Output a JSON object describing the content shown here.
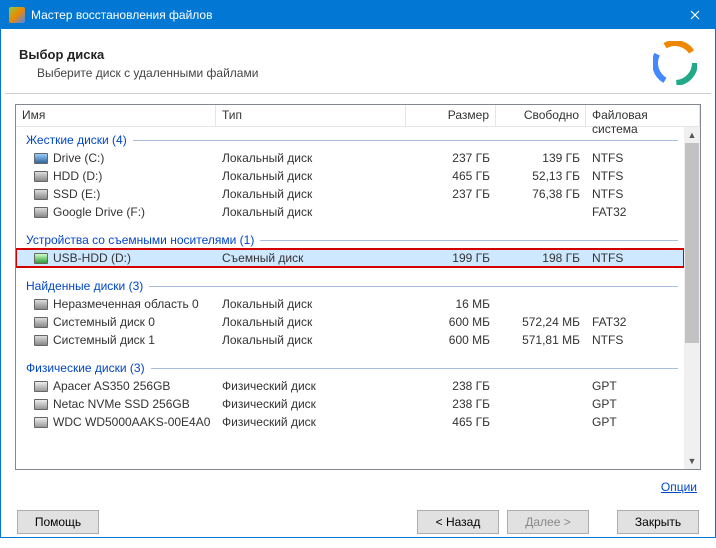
{
  "titlebar": {
    "title": "Мастер восстановления файлов"
  },
  "header": {
    "title": "Выбор диска",
    "subtitle": "Выберите диск с удаленными файлами"
  },
  "columns": {
    "name": "Имя",
    "type": "Тип",
    "size": "Размер",
    "free": "Свободно",
    "fs": "Файловая система"
  },
  "groups": [
    {
      "label": "Жесткие диски",
      "count": 4,
      "items": [
        {
          "icon": "ssd",
          "name": "Drive (C:)",
          "type": "Локальный диск",
          "size": "237 ГБ",
          "free": "139 ГБ",
          "fs": "NTFS"
        },
        {
          "icon": "hdd",
          "name": "HDD (D:)",
          "type": "Локальный диск",
          "size": "465 ГБ",
          "free": "52,13 ГБ",
          "fs": "NTFS"
        },
        {
          "icon": "hdd",
          "name": "SSD (E:)",
          "type": "Локальный диск",
          "size": "237 ГБ",
          "free": "76,38 ГБ",
          "fs": "NTFS"
        },
        {
          "icon": "hdd",
          "name": "Google Drive (F:)",
          "type": "Локальный диск",
          "size": "",
          "free": "",
          "fs": "FAT32"
        }
      ]
    },
    {
      "label": "Устройства со съемными носителями",
      "count": 1,
      "items": [
        {
          "icon": "usb",
          "name": "USB-HDD (D:)",
          "type": "Съемный диск",
          "size": "199 ГБ",
          "free": "198 ГБ",
          "fs": "NTFS",
          "selected": true,
          "highlighted": true
        }
      ]
    },
    {
      "label": "Найденные диски",
      "count": 3,
      "items": [
        {
          "icon": "hdd",
          "name": "Неразмеченная область 0",
          "type": "Локальный диск",
          "size": "16 МБ",
          "free": "",
          "fs": ""
        },
        {
          "icon": "hdd",
          "name": "Системный диск 0",
          "type": "Локальный диск",
          "size": "600 МБ",
          "free": "572,24 МБ",
          "fs": "FAT32"
        },
        {
          "icon": "hdd",
          "name": "Системный диск 1",
          "type": "Локальный диск",
          "size": "600 МБ",
          "free": "571,81 МБ",
          "fs": "NTFS"
        }
      ]
    },
    {
      "label": "Физические диски",
      "count": 3,
      "items": [
        {
          "icon": "phys",
          "name": "Apacer AS350 256GB",
          "type": "Физический диск",
          "size": "238 ГБ",
          "free": "",
          "fs": "GPT"
        },
        {
          "icon": "phys",
          "name": "Netac NVMe SSD 256GB",
          "type": "Физический диск",
          "size": "238 ГБ",
          "free": "",
          "fs": "GPT"
        },
        {
          "icon": "phys",
          "name": "WDC WD5000AAKS-00E4A0",
          "type": "Физический диск",
          "size": "465 ГБ",
          "free": "",
          "fs": "GPT"
        }
      ]
    }
  ],
  "options_link": "Опции",
  "buttons": {
    "help": "Помощь",
    "back": "< Назад",
    "next": "Далее >",
    "close": "Закрыть"
  }
}
